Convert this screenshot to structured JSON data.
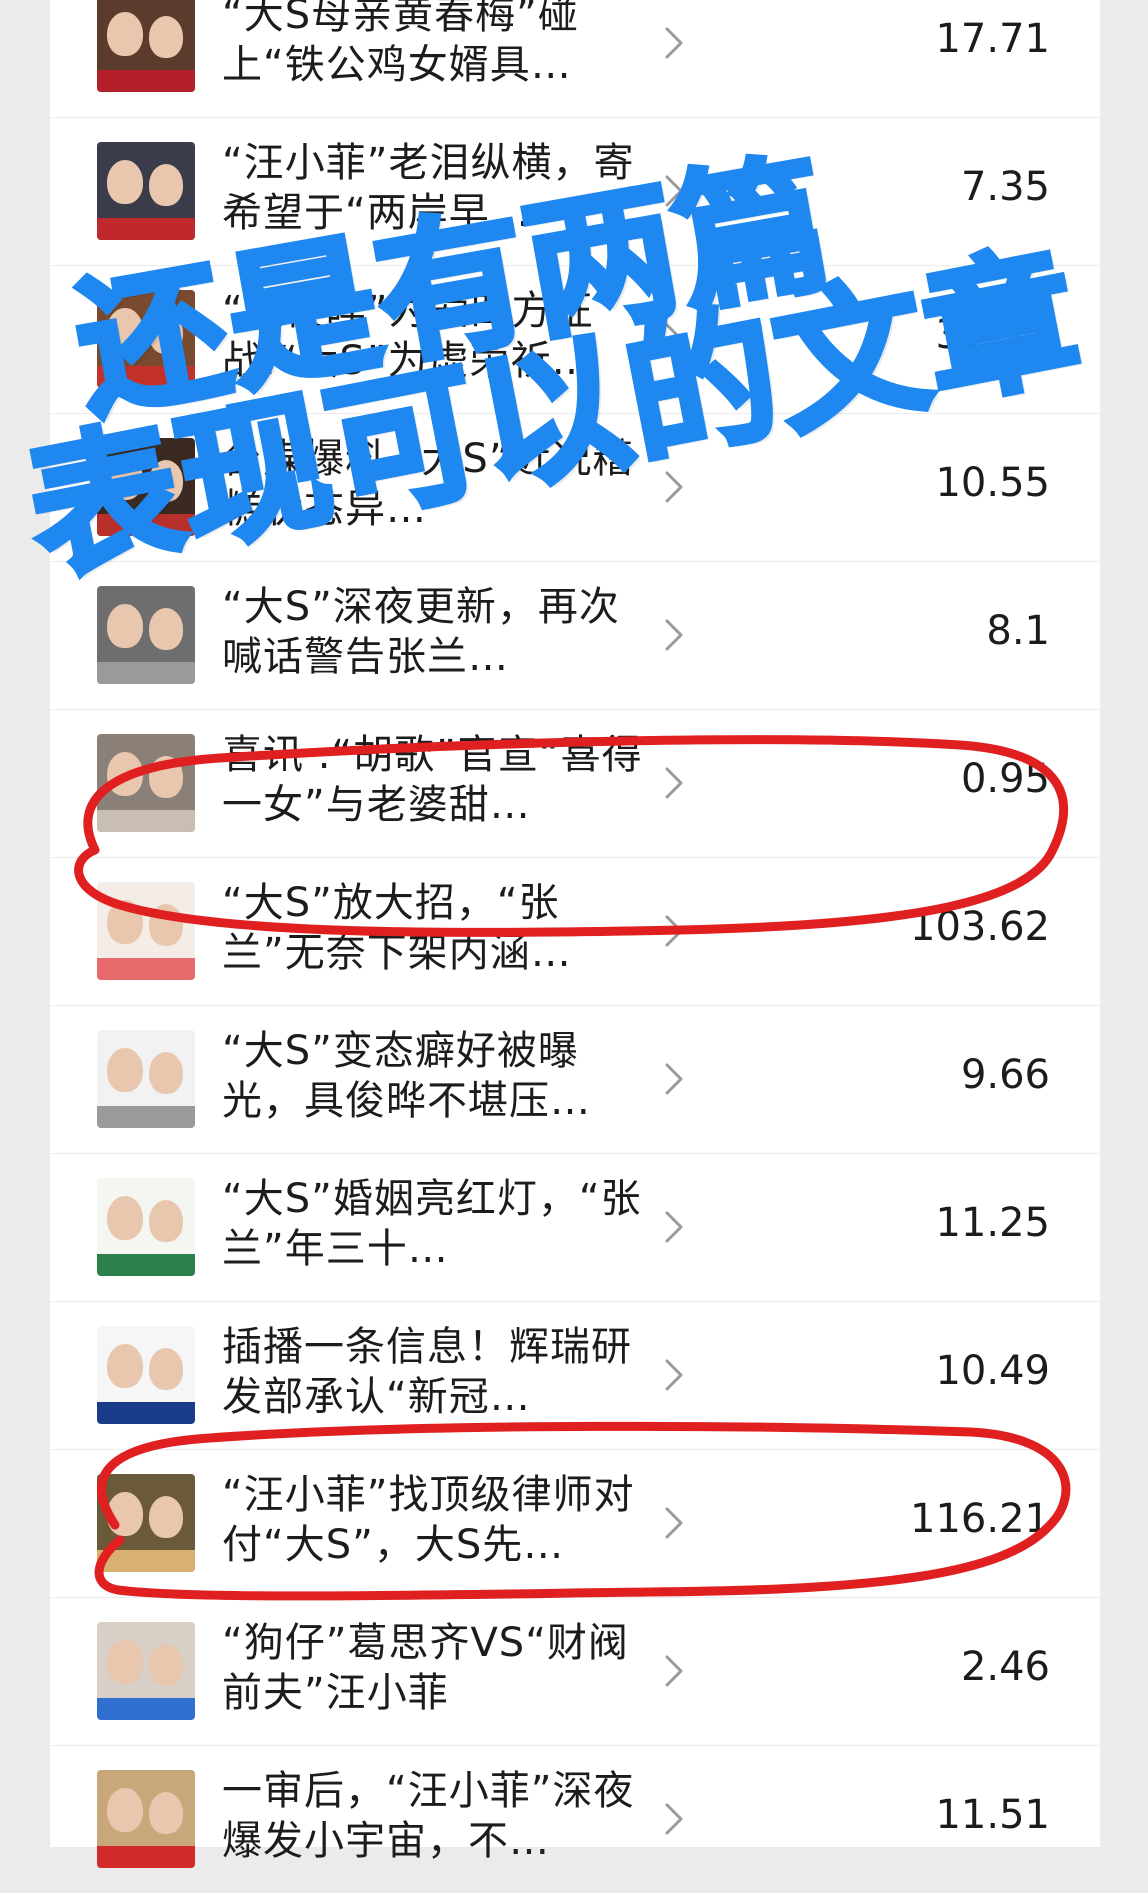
{
  "articles": [
    {
      "title": "“大S母亲黄春梅”碰上“铁公鸡女婿具…",
      "value": "17.71",
      "thumb_colors": [
        "#5a3b2c",
        "#b3202a"
      ]
    },
    {
      "title": "“汪小菲”老泪纵横，寄希望于“两岸早…",
      "value": "7.35",
      "thumb_colors": [
        "#3a3c4a",
        "#c0282c"
      ]
    },
    {
      "title": "“具俊晔”为爱四方征战.“大S”为虚荣祈…",
      "value": "32.32",
      "thumb_colors": [
        "#7a4a2e",
        "#c2322b"
      ]
    },
    {
      "title": "台媒爆料.“大S”近况糟糕状态异…",
      "value": "10.55",
      "thumb_colors": [
        "#3b2a22",
        "#b8302a"
      ]
    },
    {
      "title": "“大S”深夜更新，再次喊话警告张兰…",
      "value": "8.1",
      "thumb_colors": [
        "#6e6e6e",
        "#9a9a9a"
      ]
    },
    {
      "title": "喜讯 .“胡歌”官宣“喜得一女”与老婆甜…",
      "value": "0.95",
      "thumb_colors": [
        "#8a8078",
        "#c9beb2"
      ]
    },
    {
      "title": "“大S”放大招，“张兰”无奈下架内涵…",
      "value": "103.62",
      "thumb_colors": [
        "#f4ece6",
        "#e76a6a"
      ]
    },
    {
      "title": "“大S”变态癖好被曝光，具俊晔不堪压…",
      "value": "9.66",
      "thumb_colors": [
        "#f2f2f2",
        "#9a9a9a"
      ]
    },
    {
      "title": "“大S”婚姻亮红灯，“张兰”年三十…",
      "value": "11.25",
      "thumb_colors": [
        "#f4f6f2",
        "#2a7f4a"
      ]
    },
    {
      "title": "插播一条信息！辉瑞研发部承认“新冠…",
      "value": "10.49",
      "thumb_colors": [
        "#f6f6f6",
        "#1a3a8a"
      ]
    },
    {
      "title": "“汪小菲”找顶级律师对付“大S”，大S先…",
      "value": "116.21",
      "thumb_colors": [
        "#6a5a3a",
        "#d8b070"
      ]
    },
    {
      "title": "“狗仔”葛思齐VS“财阀前夫”汪小菲",
      "value": "2.46",
      "thumb_colors": [
        "#d8cfc6",
        "#2f6fd0"
      ]
    },
    {
      "title": "一审后，“汪小菲”深夜爆发小宇宙，不…",
      "value": "11.51",
      "thumb_colors": [
        "#c8a87a",
        "#d22a2a"
      ]
    }
  ],
  "overlay_text": {
    "line1": "还是有两篇",
    "line2": "表现可以的文章"
  },
  "colors": {
    "stamp_blue": "#1e87f0",
    "circle_red": "#e02020",
    "chevron_gray": "#9a9a9a",
    "text_dark": "#1c1c1c",
    "page_bg": "#ebebeb",
    "panel_bg": "#ffffff"
  },
  "icons": {
    "row_chevron": "chevron-right-icon"
  }
}
